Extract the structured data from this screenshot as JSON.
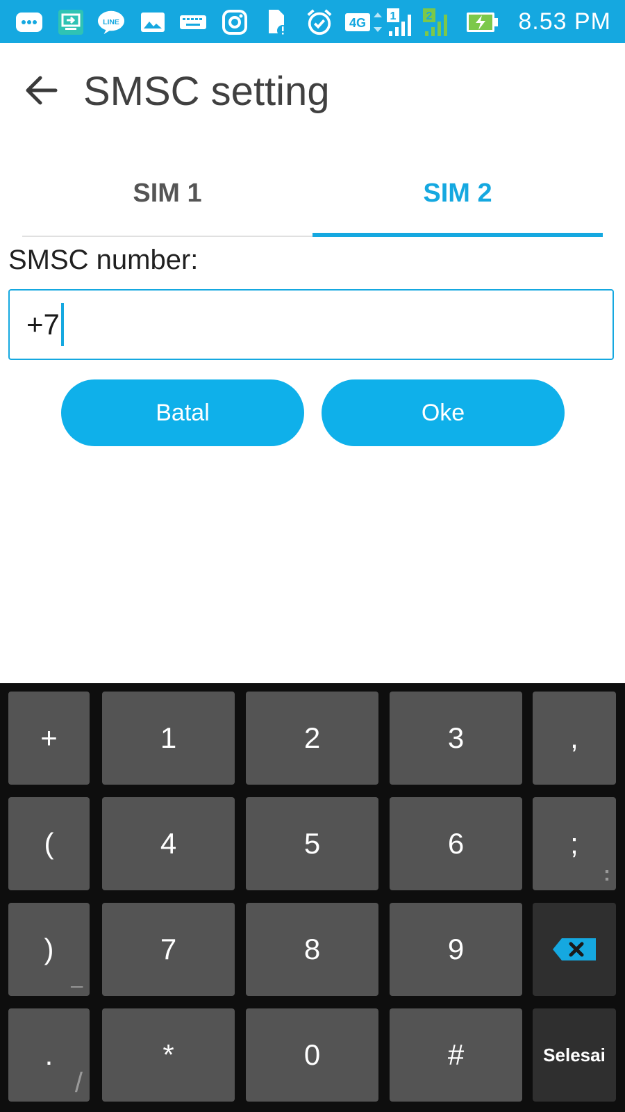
{
  "status_bar": {
    "time": "8.53 PM",
    "network_label": "4G",
    "sim1_label": "1",
    "sim2_label": "2",
    "accent_color": "#15a8e0",
    "icons": [
      "more-notifications-icon",
      "screen-cast-icon",
      "line-app-icon",
      "gallery-icon",
      "keyboard-icon",
      "instagram-icon",
      "sim-alert-icon",
      "alarm-icon",
      "signal-sim1-icon",
      "signal-sim2-icon",
      "battery-charging-icon"
    ]
  },
  "header": {
    "title": "SMSC setting",
    "back_icon": "back-arrow-icon"
  },
  "tabs": [
    {
      "label": "SIM 1",
      "selected": false
    },
    {
      "label": "SIM 2",
      "selected": true
    }
  ],
  "form": {
    "label": "SMSC number:",
    "input_value": "+7"
  },
  "buttons": {
    "cancel": "Batal",
    "ok": "Oke",
    "color": "#0fb0ea"
  },
  "keyboard": {
    "rows": [
      [
        "+",
        "1",
        "2",
        "3",
        ","
      ],
      [
        "(",
        "4",
        "5",
        "6",
        ";"
      ],
      [
        ")",
        "7",
        "8",
        "9",
        "backspace"
      ],
      [
        ".",
        "*",
        "0",
        "#",
        "Selesai"
      ]
    ],
    "secondary": {
      ";": ":",
      ")": "_",
      ".": "/"
    },
    "backspace_icon": "backspace-icon"
  }
}
